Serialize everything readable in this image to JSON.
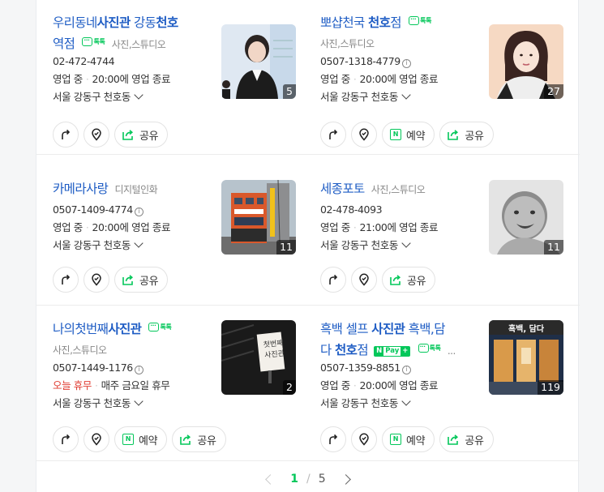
{
  "listings": [
    {
      "name": "우리동네사진관 강동천호역점",
      "category": "사진,스튜디오",
      "talktalk": "톡톡",
      "phone": "02-472-4744",
      "status": "영업 중",
      "hours": "20:00에 영업 종료",
      "address": "서울 강동구 천호동",
      "photo_count": "5",
      "actions": [
        "길찾기",
        "저장",
        "공유"
      ]
    },
    {
      "name": "뽀샵천국 천호점",
      "category": "사진,스튜디오",
      "talktalk": "톡톡",
      "phone": "0507-1318-4779",
      "status": "영업 중",
      "hours": "20:00에 영업 종료",
      "address": "서울 강동구 천호동",
      "photo_count": "27",
      "actions": [
        "길찾기",
        "저장",
        "예약",
        "공유"
      ]
    },
    {
      "name": "카메라사랑",
      "category": "디지털인화",
      "phone": "0507-1409-4774",
      "status": "영업 중",
      "hours": "20:00에 영업 종료",
      "address": "서울 강동구 천호동",
      "photo_count": "11",
      "actions": [
        "길찾기",
        "저장",
        "공유"
      ]
    },
    {
      "name": "세종포토",
      "category": "사진,스튜디오",
      "phone": "02-478-4093",
      "status": "영업 중",
      "hours": "21:00에 영업 종료",
      "address": "서울 강동구 천호동",
      "photo_count": "11",
      "actions": [
        "길찾기",
        "저장",
        "공유"
      ]
    },
    {
      "name": "나의첫번째사진관",
      "category": "사진,스튜디오",
      "talktalk": "톡톡",
      "phone": "0507-1449-1176",
      "status": "오늘 휴무",
      "hours": "매주 금요일 휴무",
      "address": "서울 강동구 천호동",
      "photo_count": "2",
      "actions": [
        "길찾기",
        "저장",
        "예약",
        "공유"
      ]
    },
    {
      "name": "흑백 셀프 사진관 흑백,담다 천호점",
      "category": "...",
      "talktalk": "톡톡",
      "npay": {
        "n": "N",
        "pay": "Pay",
        "plus": "+"
      },
      "phone": "0507-1359-8851",
      "status": "영업 중",
      "hours": "20:00에 영업 종료",
      "address": "서울 강동구 천호동",
      "photo_count": "119",
      "thumb_text": "흑백, 담다",
      "actions": [
        "길찾기",
        "저장",
        "예약",
        "공유"
      ]
    }
  ],
  "thumb_texts": {
    "sign": "첫번째 사진관"
  },
  "pagination": {
    "current": "1",
    "separator": "/",
    "total": "5"
  },
  "colors": {
    "link": "#1e5cc4",
    "naver_green": "#03c75a",
    "closed_red": "#e03c31"
  }
}
